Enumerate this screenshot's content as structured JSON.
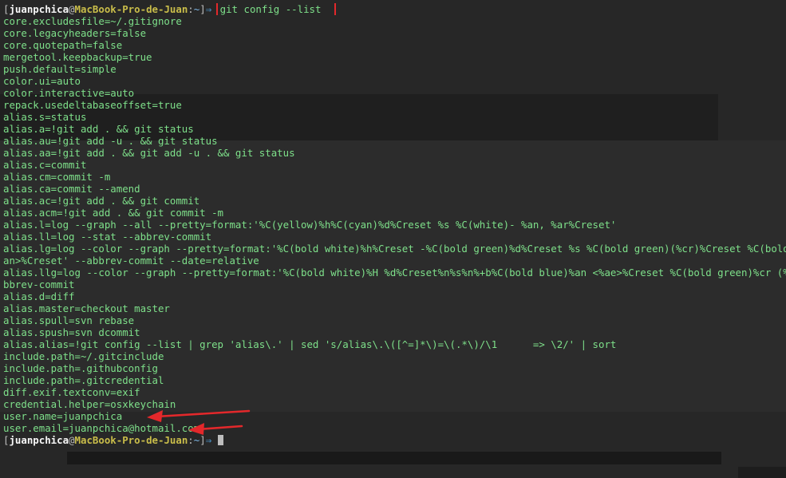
{
  "prompt": {
    "user": "juanpchica",
    "at": "@",
    "host": "MacBook-Pro-de-Juan",
    "sep": ":",
    "dir": "~",
    "bracket_open": "[",
    "bracket_close": "]",
    "arrow": "⇒"
  },
  "command": "git config --list",
  "output": [
    "core.excludesfile=~/.gitignore",
    "core.legacyheaders=false",
    "core.quotepath=false",
    "mergetool.keepbackup=true",
    "push.default=simple",
    "color.ui=auto",
    "color.interactive=auto",
    "repack.usedeltabaseoffset=true",
    "alias.s=status",
    "alias.a=!git add . && git status",
    "alias.au=!git add -u . && git status",
    "alias.aa=!git add . && git add -u . && git status",
    "alias.c=commit",
    "alias.cm=commit -m",
    "alias.ca=commit --amend",
    "alias.ac=!git add . && git commit",
    "alias.acm=!git add . && git commit -m",
    "alias.l=log --graph --all --pretty=format:'%C(yellow)%h%C(cyan)%d%Creset %s %C(white)- %an, %ar%Creset'",
    "alias.ll=log --stat --abbrev-commit",
    "alias.lg=log --color --graph --pretty=format:'%C(bold white)%h%Creset -%C(bold green)%d%Creset %s %C(bold green)(%cr)%Creset %C(bold blue)<%",
    "an>%Creset' --abbrev-commit --date=relative",
    "alias.llg=log --color --graph --pretty=format:'%C(bold white)%H %d%Creset%n%s%n%+b%C(bold blue)%an <%ae>%Creset %C(bold green)%cr (%ci)' --a",
    "bbrev-commit",
    "alias.d=diff",
    "alias.master=checkout master",
    "alias.spull=svn rebase",
    "alias.spush=svn dcommit",
    "alias.alias=!git config --list | grep 'alias\\.' | sed 's/alias\\.\\([^=]*\\)=\\(.*\\)/\\1\t => \\2/' | sort",
    "include.path=~/.gitcinclude",
    "include.path=.githubconfig",
    "include.path=.gitcredential",
    "diff.exif.textconv=exif",
    "credential.helper=osxkeychain",
    "user.name=juanpchica",
    "user.email=juanpchica@hotmail.com"
  ],
  "colors": {
    "background": "#272727",
    "text": "#7ee08a",
    "highlight_box": "#e3282b",
    "arrow": "#e3282b"
  },
  "icons": [
    "cursor-block",
    "annotation-arrow"
  ]
}
